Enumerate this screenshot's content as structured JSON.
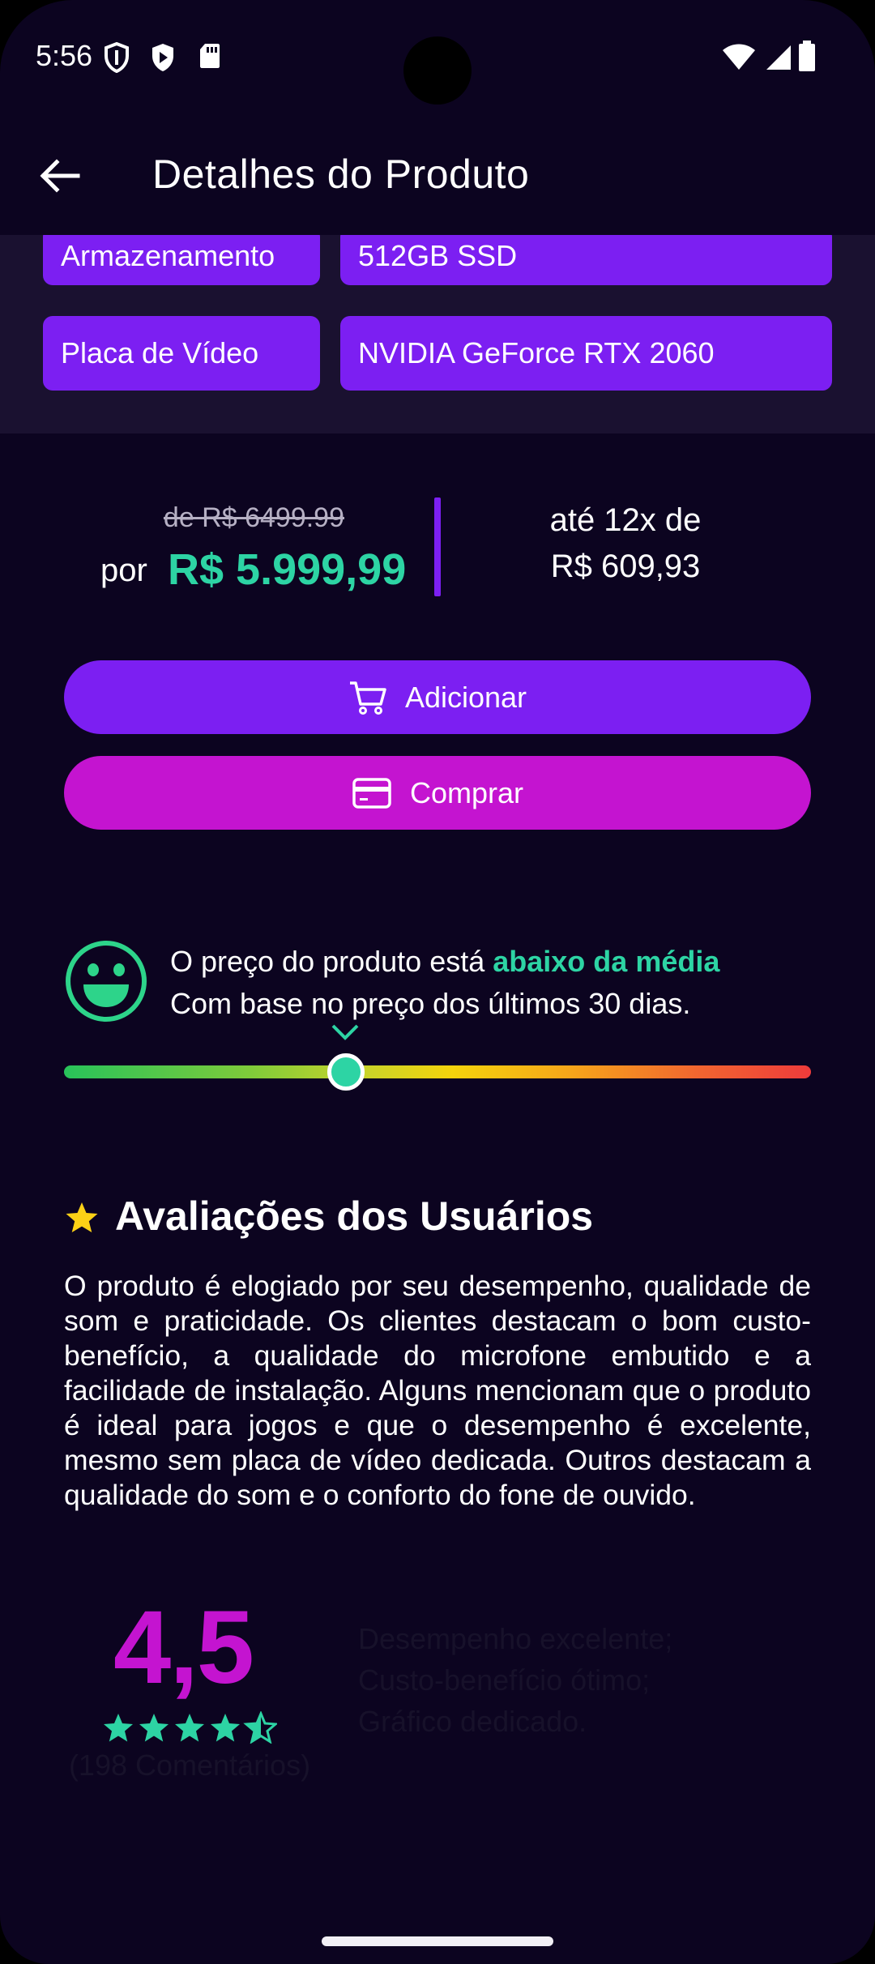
{
  "status_bar": {
    "time": "5:56"
  },
  "app_bar": {
    "title": "Detalhes do Produto"
  },
  "specs": [
    {
      "label": "Armazenamento",
      "value": "512GB SSD"
    },
    {
      "label": "Placa de Vídeo",
      "value": "NVIDIA GeForce RTX 2060"
    }
  ],
  "price": {
    "old": "de R$ 6499.99",
    "prefix": "por",
    "current": "R$ 5.999,99",
    "installments_line1": "até 12x de",
    "installments_line2": "R$ 609,93"
  },
  "buttons": {
    "add_label": "Adicionar",
    "buy_label": "Comprar"
  },
  "price_indicator": {
    "text_prefix": "O preço do produto está ",
    "text_highlight": "abaixo da média",
    "subtext": "Com base no preço dos últimos 30 dias.",
    "level": 0.377
  },
  "reviews": {
    "title": "Avaliações dos Usuários",
    "summary": "O produto é elogiado por seu desempenho, qualidade de som e praticidade. Os clientes destacam o bom custo-benefício, a qualidade do microfone embutido e a facilidade de instalação. Alguns mencionam que o produto é ideal para jogos e que o desempenho é excelente, mesmo sem placa de vídeo dedicada. Outros destacam a qualidade do som e o conforto do fone de ouvido.",
    "rating": "4,5",
    "stars": 4.5,
    "count": "(198 Comentários)",
    "pros": [
      "Desempenho excelente;",
      "Custo-benefício ótimo;",
      "Gráfico dedicado."
    ]
  },
  "colors": {
    "background": "#0c0420",
    "accent_purple": "#7c1ff2",
    "accent_magenta": "#c414d0",
    "accent_green": "#2dd4a4"
  },
  "icons": [
    "shield-outline-icon",
    "shield-play-icon",
    "sd-card-icon",
    "wifi-icon",
    "signal-icon",
    "battery-icon",
    "arrow-back-icon",
    "cart-icon",
    "credit-card-icon",
    "smiley-icon",
    "chevron-down-icon",
    "star-icon"
  ]
}
